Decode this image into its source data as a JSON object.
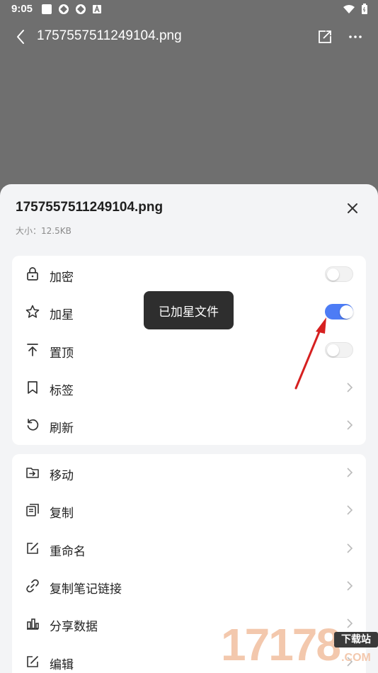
{
  "status_bar": {
    "time": "9:05"
  },
  "topbar": {
    "file_name": "1757557511249104.png"
  },
  "sheet": {
    "title": "1757557511249104.png",
    "size_text": "大小：12.5KB"
  },
  "card1": {
    "items": [
      {
        "label": "加密",
        "icon": "lock-icon",
        "control": "toggle",
        "on": false
      },
      {
        "label": "加星",
        "icon": "star-icon",
        "control": "toggle",
        "on": true
      },
      {
        "label": "置顶",
        "icon": "pin-top-icon",
        "control": "toggle",
        "on": false
      },
      {
        "label": "标签",
        "icon": "bookmark-icon",
        "control": "chevron"
      },
      {
        "label": "刷新",
        "icon": "refresh-icon",
        "control": "chevron"
      }
    ]
  },
  "card2": {
    "items": [
      {
        "label": "移动",
        "icon": "move-icon",
        "control": "chevron"
      },
      {
        "label": "复制",
        "icon": "copy-icon",
        "control": "chevron"
      },
      {
        "label": "重命名",
        "icon": "rename-icon",
        "control": "chevron"
      },
      {
        "label": "复制笔记链接",
        "icon": "link-icon",
        "control": "chevron"
      },
      {
        "label": "分享数据",
        "icon": "bar-chart-icon",
        "control": "chevron"
      },
      {
        "label": "编辑",
        "icon": "edit-icon",
        "control": "chevron"
      }
    ]
  },
  "toast": {
    "text": "已加星文件"
  },
  "watermark": {
    "digits": "17178",
    "tag": "下载站",
    "suffix": ".COM"
  },
  "colors": {
    "accent": "#4d7cf5",
    "toast_bg": "#2e2e2e",
    "arrow": "#d62020"
  }
}
